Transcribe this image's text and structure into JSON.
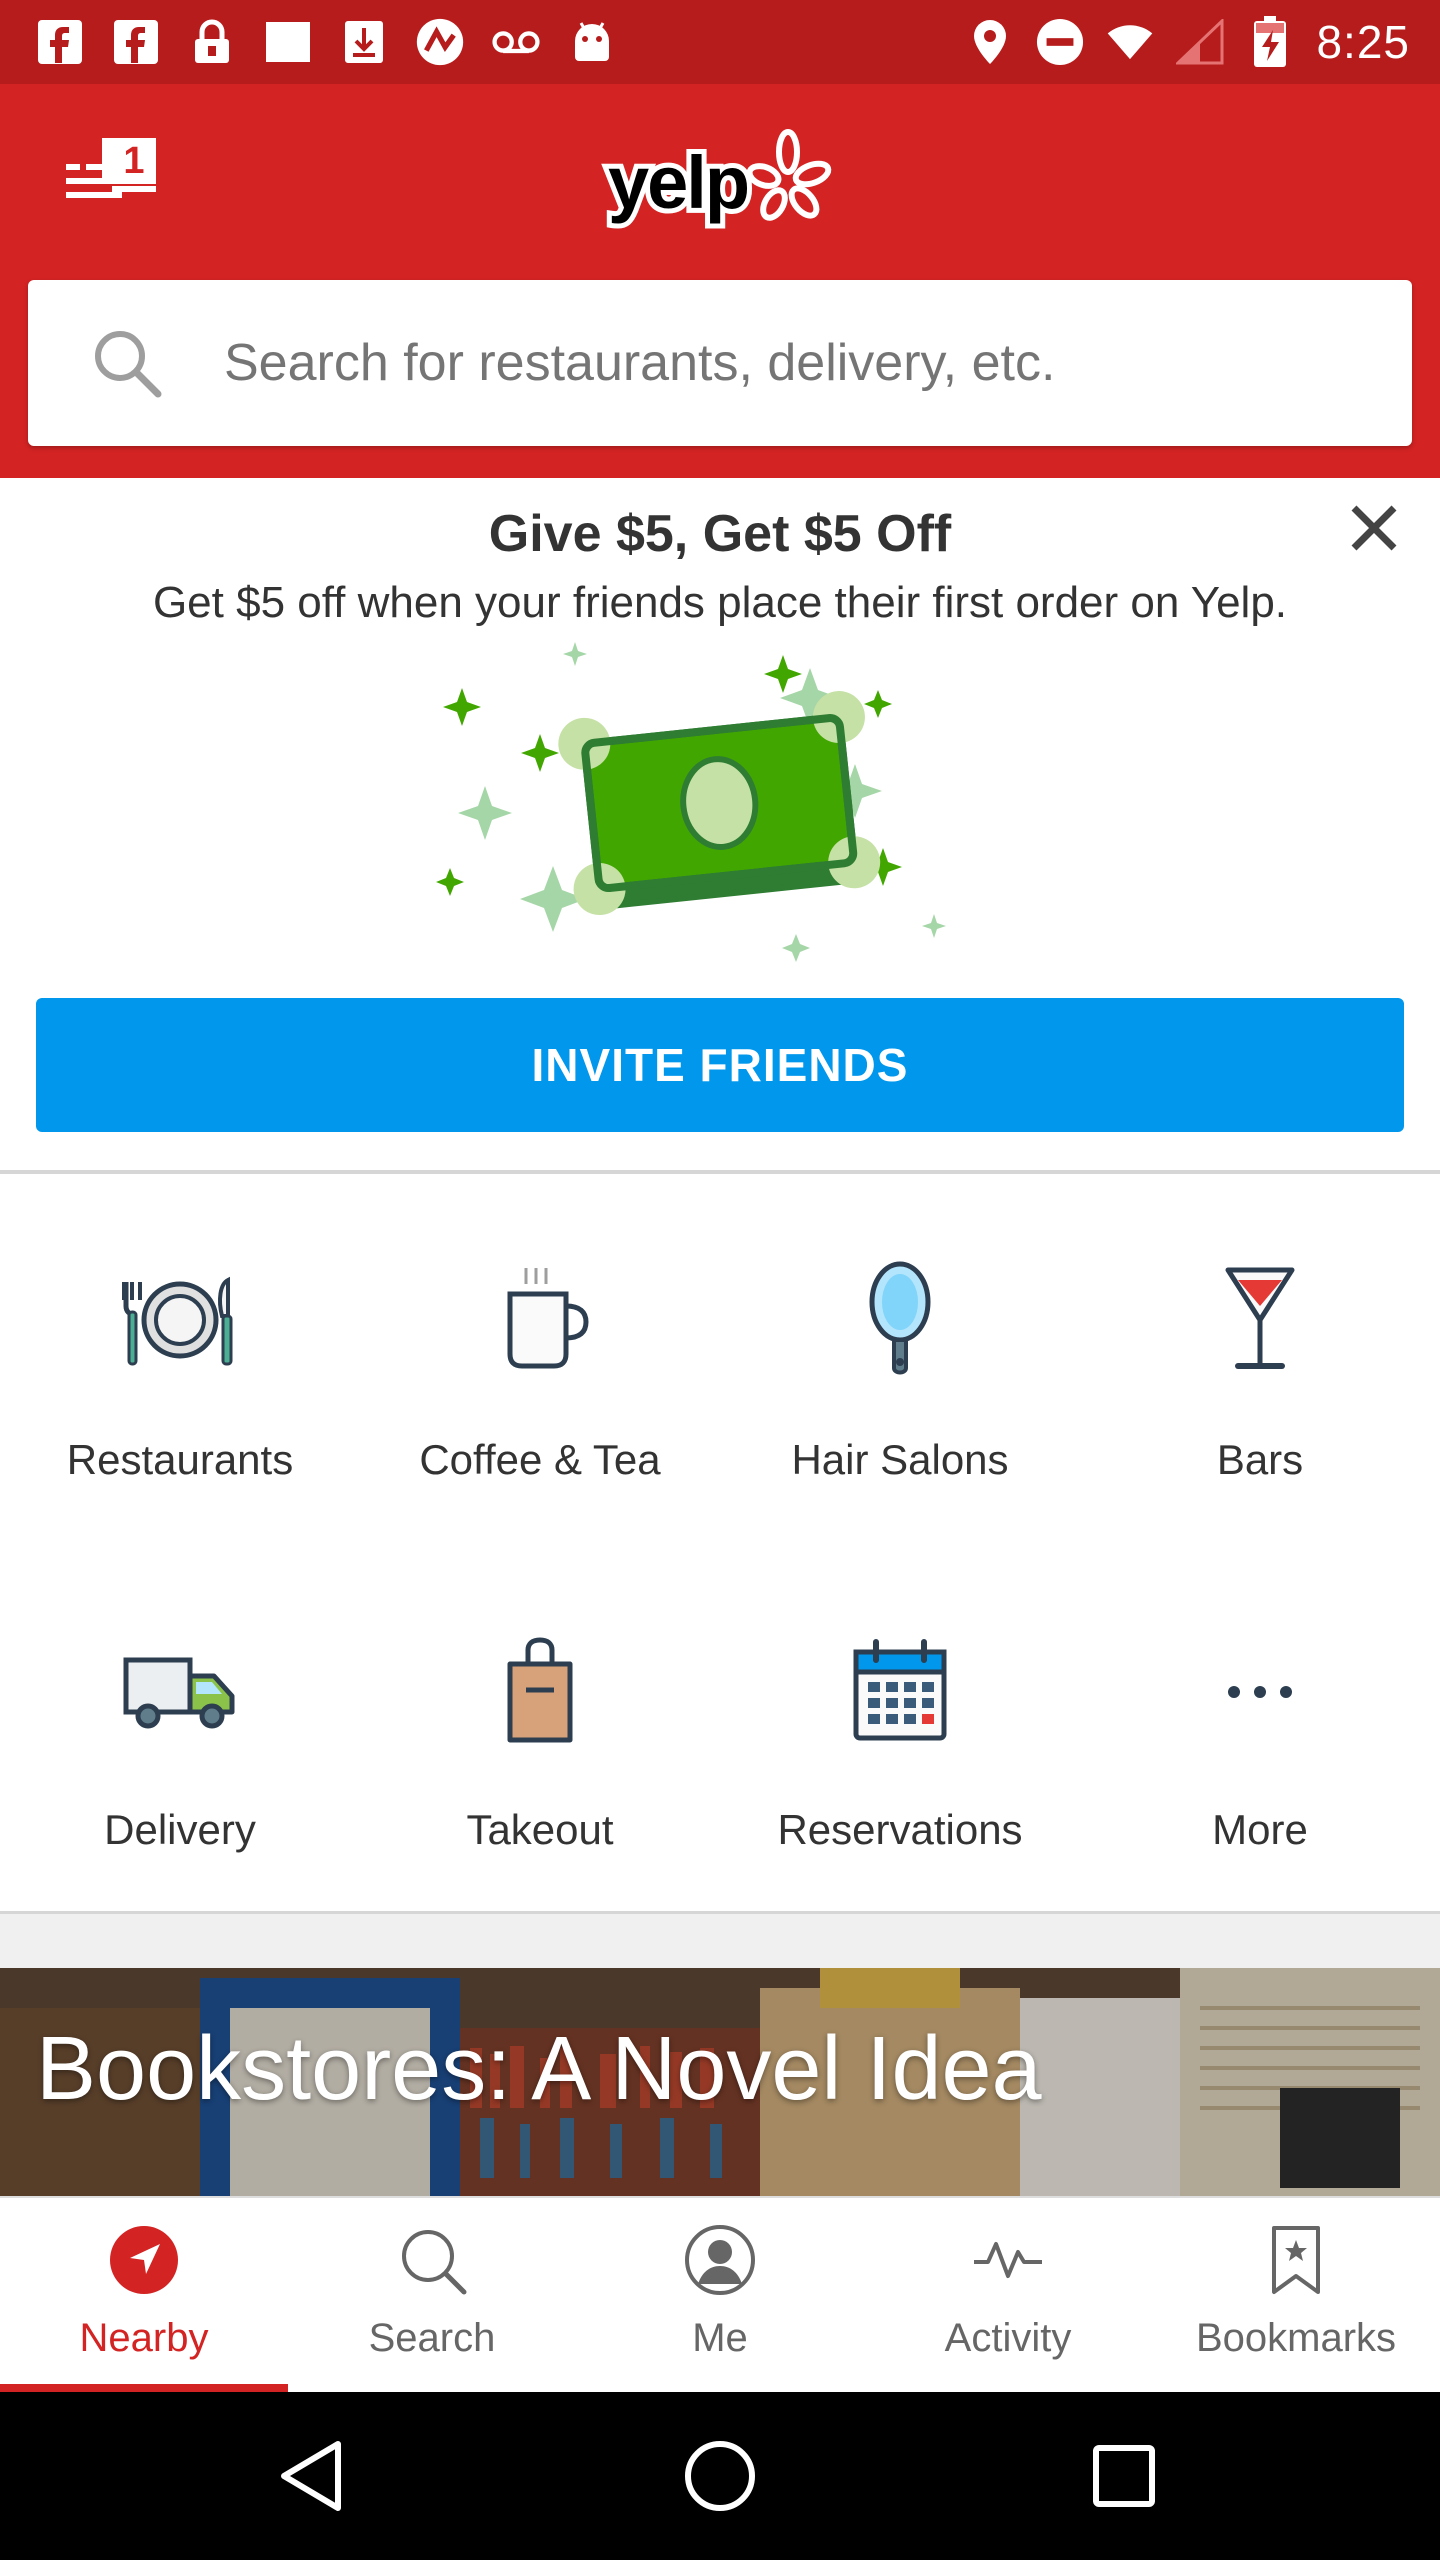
{
  "status_bar": {
    "time": "8:25",
    "left_icons": [
      "facebook-icon",
      "facebook-icon",
      "lock-icon",
      "square-icon",
      "download-icon",
      "nintendo-icon",
      "voicemail-icon",
      "android-icon"
    ],
    "right_icons": [
      "location-icon",
      "do-not-disturb-icon",
      "wifi-icon",
      "signal-icon",
      "battery-charging-icon"
    ]
  },
  "header": {
    "logo_text": "yelp",
    "notification_count": "1",
    "search_placeholder": "Search for restaurants, delivery, etc."
  },
  "promo": {
    "title": "Give $5, Get $5 Off",
    "subtitle": "Get $5 off when your friends place their first order on Yelp.",
    "button_label": "INVITE FRIENDS"
  },
  "categories": [
    {
      "label": "Restaurants",
      "icon": "plate-cutlery-icon"
    },
    {
      "label": "Coffee & Tea",
      "icon": "coffee-cup-icon"
    },
    {
      "label": "Hair Salons",
      "icon": "hand-mirror-icon"
    },
    {
      "label": "Bars",
      "icon": "cocktail-icon"
    },
    {
      "label": "Delivery",
      "icon": "delivery-truck-icon"
    },
    {
      "label": "Takeout",
      "icon": "takeout-bag-icon"
    },
    {
      "label": "Reservations",
      "icon": "calendar-icon"
    },
    {
      "label": "More",
      "icon": "more-dots-icon"
    }
  ],
  "banner": {
    "title": "Bookstores: A Novel Idea"
  },
  "bottom_nav": [
    {
      "label": "Nearby",
      "icon": "nearby-compass-icon",
      "active": true
    },
    {
      "label": "Search",
      "icon": "search-icon",
      "active": false
    },
    {
      "label": "Me",
      "icon": "profile-icon",
      "active": false
    },
    {
      "label": "Activity",
      "icon": "activity-pulse-icon",
      "active": false
    },
    {
      "label": "Bookmarks",
      "icon": "bookmark-icon",
      "active": false
    }
  ],
  "colors": {
    "brand_red": "#d32323",
    "status_bar": "#b71c1c",
    "invite_blue": "#0097ec",
    "money_green": "#41a700"
  }
}
